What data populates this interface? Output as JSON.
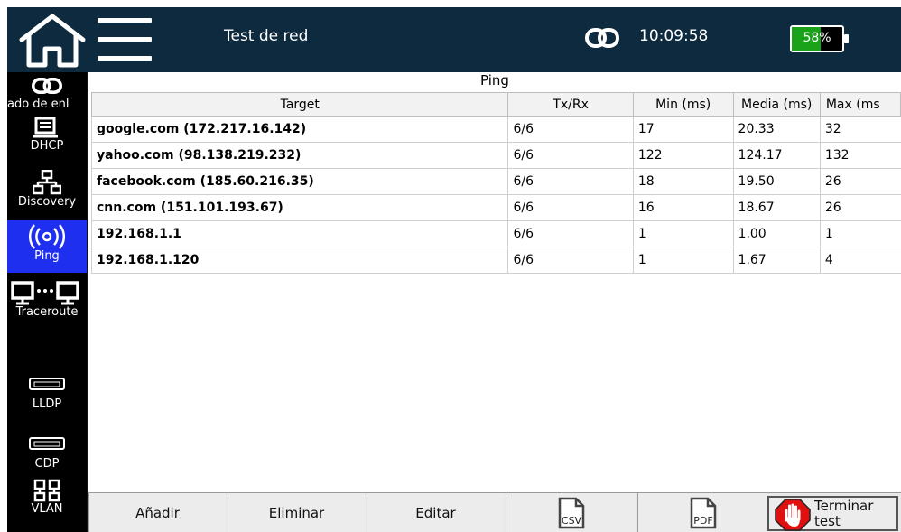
{
  "header": {
    "title": "Test de red",
    "clock": "10:09:58",
    "battery_label": "58%",
    "battery_level": 0.58
  },
  "sidebar": {
    "items": [
      {
        "label": "",
        "icon": "link-icon"
      },
      {
        "label": "ado de enl",
        "icon": "link-icon"
      },
      {
        "label": "DHCP",
        "icon": "dhcp-icon"
      },
      {
        "label": "Discovery",
        "icon": "network-icon"
      },
      {
        "label": "Ping",
        "icon": "wireless-icon"
      },
      {
        "label": "Traceroute",
        "icon": "traceroute-icon"
      },
      {
        "label": "LLDP",
        "icon": "port-icon"
      },
      {
        "label": "CDP",
        "icon": "port-icon"
      },
      {
        "label": "VLAN",
        "icon": "vlan-icon"
      }
    ]
  },
  "main": {
    "section_title": "Ping",
    "table": {
      "headers": [
        "Target",
        "Tx/Rx",
        "Min (ms)",
        "Media (ms)",
        "Max (ms"
      ],
      "rows": [
        [
          "google.com (172.217.16.142)",
          "6/6",
          "17",
          "20.33",
          "32"
        ],
        [
          "yahoo.com (98.138.219.232)",
          "6/6",
          "122",
          "124.17",
          "132"
        ],
        [
          "facebook.com (185.60.216.35)",
          "6/6",
          "18",
          "19.50",
          "26"
        ],
        [
          "cnn.com (151.101.193.67)",
          "6/6",
          "16",
          "18.67",
          "26"
        ],
        [
          "192.168.1.1",
          "6/6",
          "1",
          "1.00",
          "1"
        ],
        [
          "192.168.1.120",
          "6/6",
          "1",
          "1.67",
          "4"
        ]
      ]
    }
  },
  "toolbar": {
    "add_label": "Añadir",
    "delete_label": "Eliminar",
    "edit_label": "Editar",
    "csv_label": "CSV",
    "pdf_label": "PDF",
    "stop_label": "Terminar\ntest"
  },
  "colors": {
    "topbar": "#0d2a3f",
    "sidebar_active": "#1f2ff0",
    "battery_fill": "#1aa31a",
    "stop_red": "#e01010"
  }
}
